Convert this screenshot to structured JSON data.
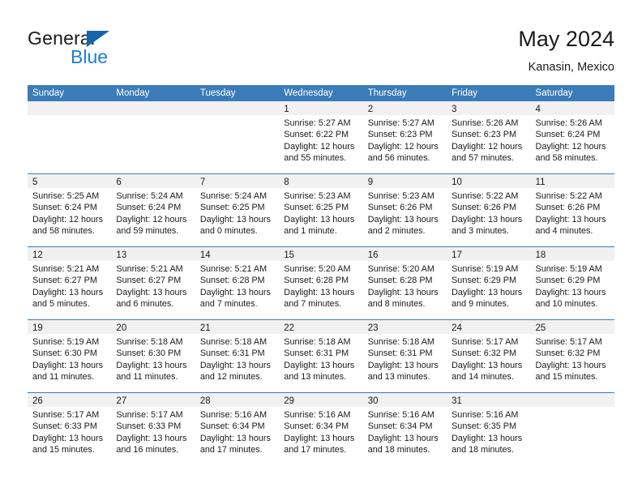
{
  "brand": {
    "name_part1": "General",
    "name_part2": "Blue",
    "logo_icon": "triangle-logo-icon",
    "accent_color": "#1a7fd4",
    "logo_color": "#1565a8"
  },
  "header": {
    "title": "May 2024",
    "location": "Kanasin, Mexico"
  },
  "theme": {
    "header_blue": "#3b7cb8",
    "daynum_band": "#f1f1f1",
    "text": "#1a1a1a"
  },
  "calendar": {
    "weekday_headers": [
      "Sunday",
      "Monday",
      "Tuesday",
      "Wednesday",
      "Thursday",
      "Friday",
      "Saturday"
    ],
    "weeks": [
      [
        {
          "day": "",
          "empty": true,
          "lines": []
        },
        {
          "day": "",
          "empty": true,
          "lines": []
        },
        {
          "day": "",
          "empty": true,
          "lines": []
        },
        {
          "day": "1",
          "empty": false,
          "lines": [
            "Sunrise: 5:27 AM",
            "Sunset: 6:22 PM",
            "Daylight: 12 hours",
            "and 55 minutes."
          ]
        },
        {
          "day": "2",
          "empty": false,
          "lines": [
            "Sunrise: 5:27 AM",
            "Sunset: 6:23 PM",
            "Daylight: 12 hours",
            "and 56 minutes."
          ]
        },
        {
          "day": "3",
          "empty": false,
          "lines": [
            "Sunrise: 5:26 AM",
            "Sunset: 6:23 PM",
            "Daylight: 12 hours",
            "and 57 minutes."
          ]
        },
        {
          "day": "4",
          "empty": false,
          "lines": [
            "Sunrise: 5:26 AM",
            "Sunset: 6:24 PM",
            "Daylight: 12 hours",
            "and 58 minutes."
          ]
        }
      ],
      [
        {
          "day": "5",
          "empty": false,
          "lines": [
            "Sunrise: 5:25 AM",
            "Sunset: 6:24 PM",
            "Daylight: 12 hours",
            "and 58 minutes."
          ]
        },
        {
          "day": "6",
          "empty": false,
          "lines": [
            "Sunrise: 5:24 AM",
            "Sunset: 6:24 PM",
            "Daylight: 12 hours",
            "and 59 minutes."
          ]
        },
        {
          "day": "7",
          "empty": false,
          "lines": [
            "Sunrise: 5:24 AM",
            "Sunset: 6:25 PM",
            "Daylight: 13 hours",
            "and 0 minutes."
          ]
        },
        {
          "day": "8",
          "empty": false,
          "lines": [
            "Sunrise: 5:23 AM",
            "Sunset: 6:25 PM",
            "Daylight: 13 hours",
            "and 1 minute."
          ]
        },
        {
          "day": "9",
          "empty": false,
          "lines": [
            "Sunrise: 5:23 AM",
            "Sunset: 6:26 PM",
            "Daylight: 13 hours",
            "and 2 minutes."
          ]
        },
        {
          "day": "10",
          "empty": false,
          "lines": [
            "Sunrise: 5:22 AM",
            "Sunset: 6:26 PM",
            "Daylight: 13 hours",
            "and 3 minutes."
          ]
        },
        {
          "day": "11",
          "empty": false,
          "lines": [
            "Sunrise: 5:22 AM",
            "Sunset: 6:26 PM",
            "Daylight: 13 hours",
            "and 4 minutes."
          ]
        }
      ],
      [
        {
          "day": "12",
          "empty": false,
          "lines": [
            "Sunrise: 5:21 AM",
            "Sunset: 6:27 PM",
            "Daylight: 13 hours",
            "and 5 minutes."
          ]
        },
        {
          "day": "13",
          "empty": false,
          "lines": [
            "Sunrise: 5:21 AM",
            "Sunset: 6:27 PM",
            "Daylight: 13 hours",
            "and 6 minutes."
          ]
        },
        {
          "day": "14",
          "empty": false,
          "lines": [
            "Sunrise: 5:21 AM",
            "Sunset: 6:28 PM",
            "Daylight: 13 hours",
            "and 7 minutes."
          ]
        },
        {
          "day": "15",
          "empty": false,
          "lines": [
            "Sunrise: 5:20 AM",
            "Sunset: 6:28 PM",
            "Daylight: 13 hours",
            "and 7 minutes."
          ]
        },
        {
          "day": "16",
          "empty": false,
          "lines": [
            "Sunrise: 5:20 AM",
            "Sunset: 6:28 PM",
            "Daylight: 13 hours",
            "and 8 minutes."
          ]
        },
        {
          "day": "17",
          "empty": false,
          "lines": [
            "Sunrise: 5:19 AM",
            "Sunset: 6:29 PM",
            "Daylight: 13 hours",
            "and 9 minutes."
          ]
        },
        {
          "day": "18",
          "empty": false,
          "lines": [
            "Sunrise: 5:19 AM",
            "Sunset: 6:29 PM",
            "Daylight: 13 hours",
            "and 10 minutes."
          ]
        }
      ],
      [
        {
          "day": "19",
          "empty": false,
          "lines": [
            "Sunrise: 5:19 AM",
            "Sunset: 6:30 PM",
            "Daylight: 13 hours",
            "and 11 minutes."
          ]
        },
        {
          "day": "20",
          "empty": false,
          "lines": [
            "Sunrise: 5:18 AM",
            "Sunset: 6:30 PM",
            "Daylight: 13 hours",
            "and 11 minutes."
          ]
        },
        {
          "day": "21",
          "empty": false,
          "lines": [
            "Sunrise: 5:18 AM",
            "Sunset: 6:31 PM",
            "Daylight: 13 hours",
            "and 12 minutes."
          ]
        },
        {
          "day": "22",
          "empty": false,
          "lines": [
            "Sunrise: 5:18 AM",
            "Sunset: 6:31 PM",
            "Daylight: 13 hours",
            "and 13 minutes."
          ]
        },
        {
          "day": "23",
          "empty": false,
          "lines": [
            "Sunrise: 5:18 AM",
            "Sunset: 6:31 PM",
            "Daylight: 13 hours",
            "and 13 minutes."
          ]
        },
        {
          "day": "24",
          "empty": false,
          "lines": [
            "Sunrise: 5:17 AM",
            "Sunset: 6:32 PM",
            "Daylight: 13 hours",
            "and 14 minutes."
          ]
        },
        {
          "day": "25",
          "empty": false,
          "lines": [
            "Sunrise: 5:17 AM",
            "Sunset: 6:32 PM",
            "Daylight: 13 hours",
            "and 15 minutes."
          ]
        }
      ],
      [
        {
          "day": "26",
          "empty": false,
          "lines": [
            "Sunrise: 5:17 AM",
            "Sunset: 6:33 PM",
            "Daylight: 13 hours",
            "and 15 minutes."
          ]
        },
        {
          "day": "27",
          "empty": false,
          "lines": [
            "Sunrise: 5:17 AM",
            "Sunset: 6:33 PM",
            "Daylight: 13 hours",
            "and 16 minutes."
          ]
        },
        {
          "day": "28",
          "empty": false,
          "lines": [
            "Sunrise: 5:16 AM",
            "Sunset: 6:34 PM",
            "Daylight: 13 hours",
            "and 17 minutes."
          ]
        },
        {
          "day": "29",
          "empty": false,
          "lines": [
            "Sunrise: 5:16 AM",
            "Sunset: 6:34 PM",
            "Daylight: 13 hours",
            "and 17 minutes."
          ]
        },
        {
          "day": "30",
          "empty": false,
          "lines": [
            "Sunrise: 5:16 AM",
            "Sunset: 6:34 PM",
            "Daylight: 13 hours",
            "and 18 minutes."
          ]
        },
        {
          "day": "31",
          "empty": false,
          "lines": [
            "Sunrise: 5:16 AM",
            "Sunset: 6:35 PM",
            "Daylight: 13 hours",
            "and 18 minutes."
          ]
        },
        {
          "day": "",
          "empty": true,
          "lines": []
        }
      ]
    ]
  }
}
